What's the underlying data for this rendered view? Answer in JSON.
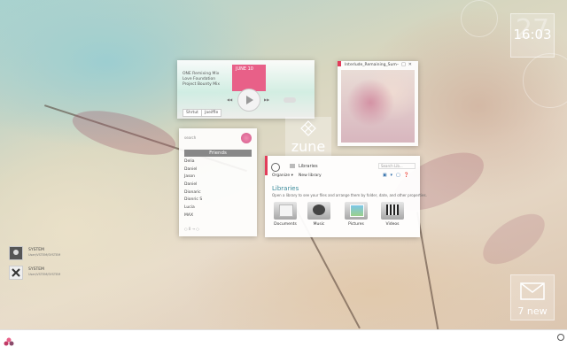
{
  "clock": {
    "time": "16:03",
    "date": "27"
  },
  "mail": {
    "count": "7 new"
  },
  "player": {
    "line1": "ONE Remixing Mix",
    "line2": "Love Foundation",
    "line3": "Project Bounty Mix",
    "album_label": "JUNE 10",
    "btn_shuffle": "Shrtut",
    "btn_repeat": "Jaeiffle"
  },
  "viewer": {
    "title": "Interlude_Remaining_Sum"
  },
  "zune": {
    "word": "zune"
  },
  "friends": {
    "search": "search",
    "heading": "Friends",
    "items": [
      "Delia",
      "Daniel",
      "Jason",
      "Daniel",
      "Dionaric",
      "Dionric S",
      "Lucia",
      "MAX"
    ],
    "footer": "○ 0      → ○"
  },
  "explorer": {
    "crumb": "Libraries",
    "search": "Search Lib...",
    "organize": "Organize ▾",
    "new_library": "New library",
    "heading": "Libraries",
    "description": "Open a library to see your files and arrange them by folder, date, and other properties.",
    "folders": [
      {
        "label": "Documents",
        "icon": "document-folder-icon"
      },
      {
        "label": "Music",
        "icon": "music-folder-icon"
      },
      {
        "label": "Pictures",
        "icon": "pictures-folder-icon"
      },
      {
        "label": "Videos",
        "icon": "videos-folder-icon"
      }
    ]
  },
  "users": [
    {
      "name": "SYSTEM",
      "sub": "User/VSTEM/SYSTEM",
      "icon": "user-silhouette-icon"
    },
    {
      "name": "SYSTEM",
      "sub": "User/VSTEM/SYSTEM",
      "icon": "x-app-icon"
    }
  ]
}
